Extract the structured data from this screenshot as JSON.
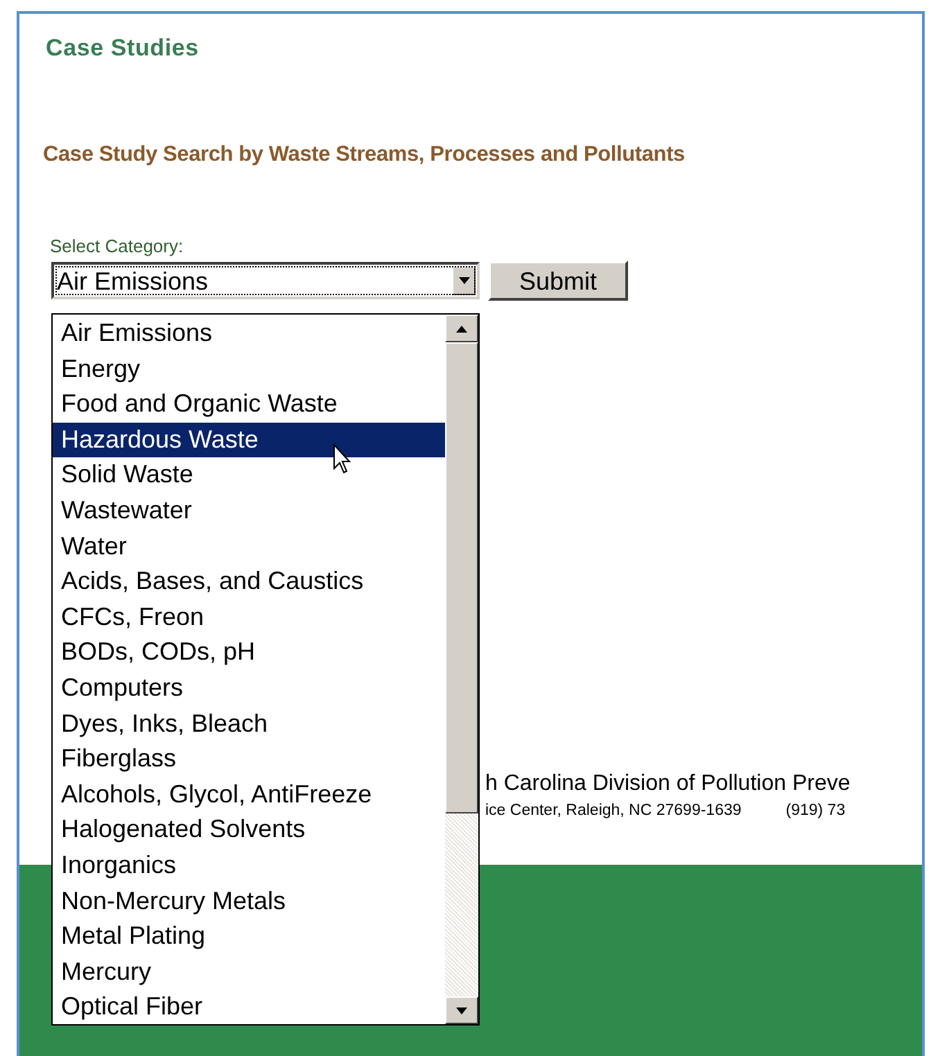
{
  "title": "Case Studies",
  "subtitle": "Case Study Search by Waste Streams, Processes and Pollutants",
  "form": {
    "label": "Select Category:",
    "value": "Air Emissions",
    "expanded": true,
    "submit": "Submit"
  },
  "options": [
    {
      "label": "Air Emissions",
      "selected": false
    },
    {
      "label": "Energy",
      "selected": false
    },
    {
      "label": "Food and Organic Waste",
      "selected": false
    },
    {
      "label": "Hazardous Waste",
      "selected": true
    },
    {
      "label": "Solid Waste",
      "selected": false
    },
    {
      "label": "Wastewater",
      "selected": false
    },
    {
      "label": "Water",
      "selected": false
    },
    {
      "label": "Acids, Bases, and Caustics",
      "selected": false
    },
    {
      "label": "CFCs, Freon",
      "selected": false
    },
    {
      "label": "BODs, CODs, pH",
      "selected": false
    },
    {
      "label": "Computers",
      "selected": false
    },
    {
      "label": "Dyes, Inks, Bleach",
      "selected": false
    },
    {
      "label": "Fiberglass",
      "selected": false
    },
    {
      "label": "Alcohols, Glycol, AntiFreeze",
      "selected": false
    },
    {
      "label": "Halogenated Solvents",
      "selected": false
    },
    {
      "label": "Inorganics",
      "selected": false
    },
    {
      "label": "Non-Mercury Metals",
      "selected": false
    },
    {
      "label": "Metal Plating",
      "selected": false
    },
    {
      "label": "Mercury",
      "selected": false
    },
    {
      "label": "Optical Fiber",
      "selected": false
    }
  ],
  "footer": {
    "line_1": "h Carolina Division of Pollution Preve",
    "line_2": "ice Center, Raleigh, NC 27699-1639",
    "phone": "(919) 73"
  }
}
